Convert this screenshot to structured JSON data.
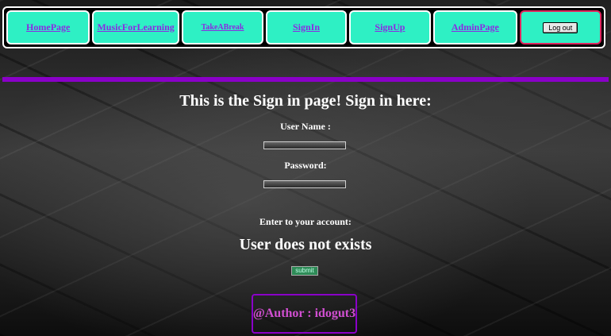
{
  "nav": {
    "items": [
      {
        "label": "HomePage"
      },
      {
        "label": "MusicForLearning"
      },
      {
        "label": "TakeABreak"
      },
      {
        "label": "SignIn"
      },
      {
        "label": "SignUp"
      },
      {
        "label": "AdminPage"
      }
    ],
    "logout_label": "Log out"
  },
  "main": {
    "title": "This is the Sign in page! Sign in here:",
    "username_label": "User Name :",
    "password_label": "Password:",
    "enter_label": "Enter to your account:",
    "status_message": "User does not exists",
    "submit_label": "submit"
  },
  "footer": {
    "author": "@Author : idogut3"
  },
  "colors": {
    "nav_bg": "#2ef0c4",
    "link": "#8a2be2",
    "accent": "#8a00c8",
    "logout_border": "#e0245e",
    "author_text": "#d14fd1"
  }
}
